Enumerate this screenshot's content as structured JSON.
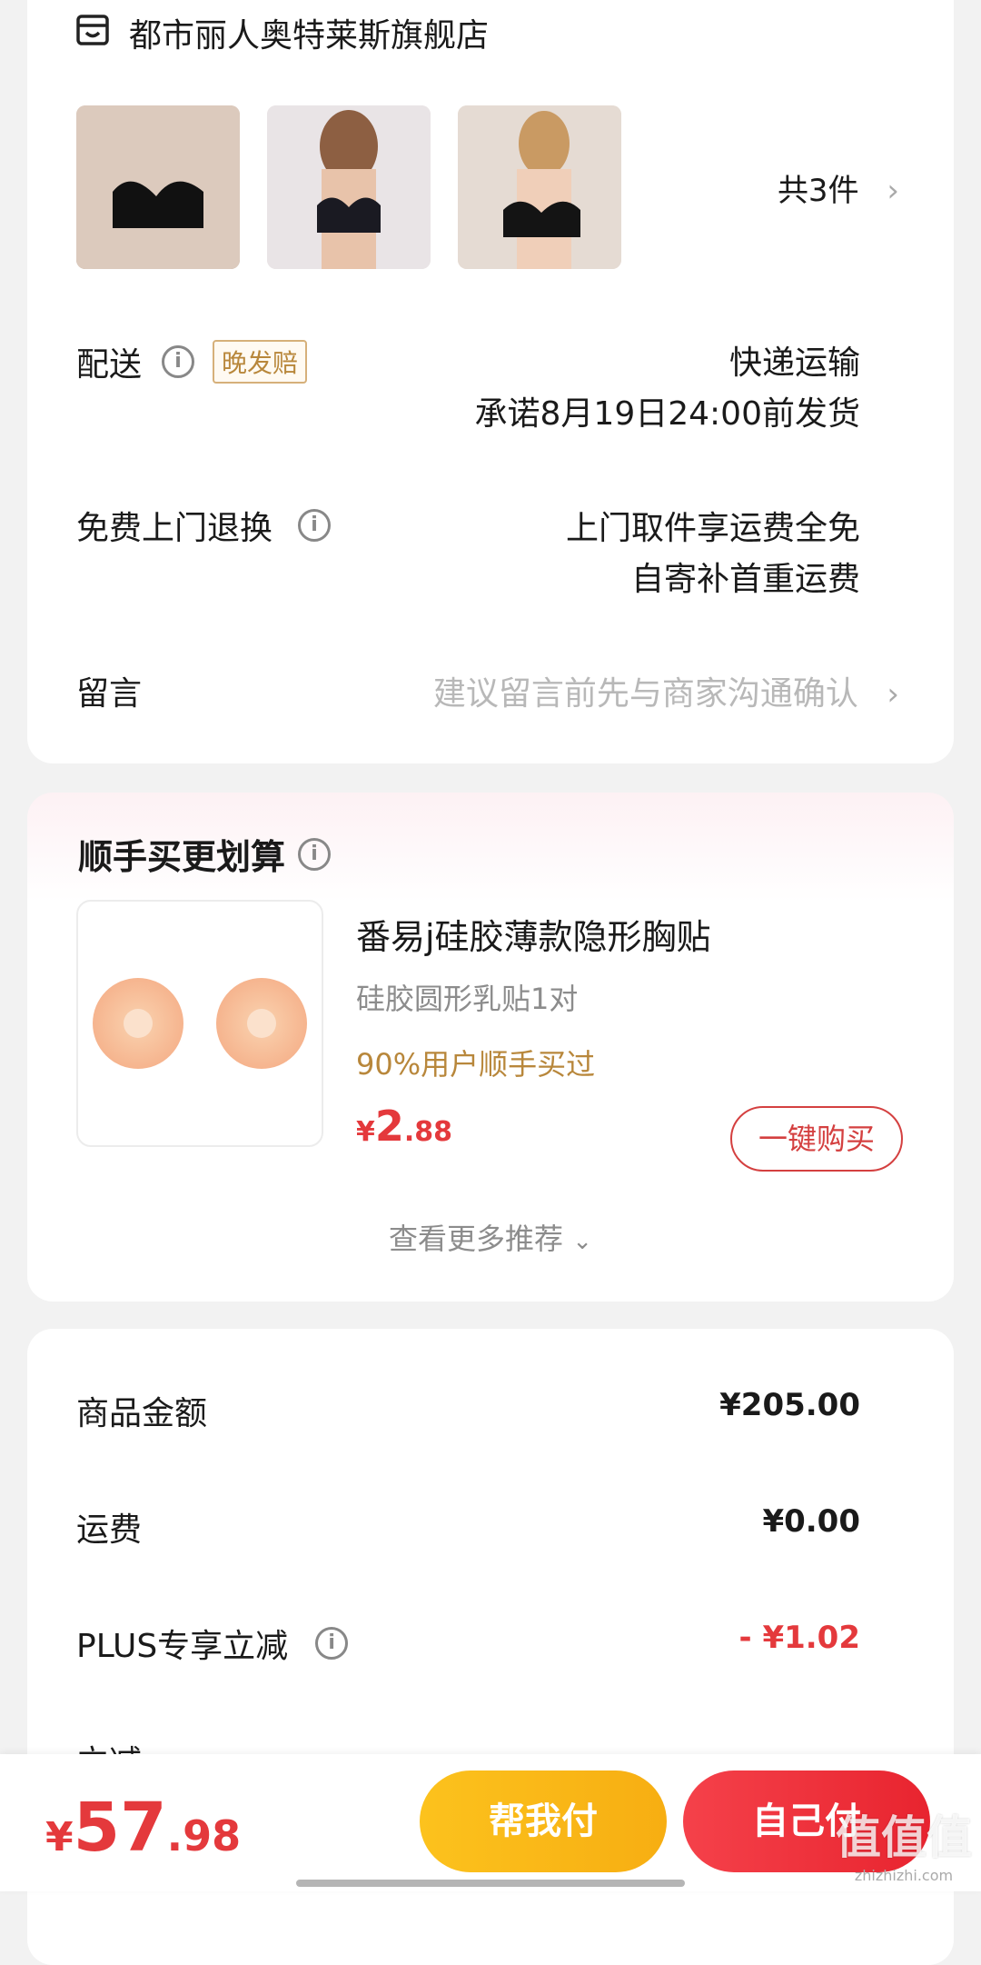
{
  "store": {
    "name": "都市丽人奥特莱斯旗舰店",
    "icon": "store-icon"
  },
  "products": {
    "count_label": "共3件"
  },
  "delivery": {
    "label": "配送",
    "badge": "晚发赔",
    "method": "快递运输",
    "promise": "承诺8月19日24:00前发货"
  },
  "returns": {
    "label": "免费上门退换",
    "line1": "上门取件享运费全免",
    "line2": "自寄补首重运费"
  },
  "message": {
    "label": "留言",
    "placeholder": "建议留言前先与商家沟通确认"
  },
  "addon": {
    "title": "顺手买更划算",
    "product_title": "番易j硅胶薄款隐形胸贴",
    "spec": "硅胶圆形乳贴1对",
    "social_proof": "90%用户顺手买过",
    "price_symbol": "¥",
    "price_int": "2",
    "price_dec": ".88",
    "buy_label": "一键购买",
    "more_label": "查看更多推荐"
  },
  "summary": {
    "goods_label": "商品金额",
    "goods_value": "¥205.00",
    "shipping_label": "运费",
    "shipping_value": "¥0.00",
    "plus_label": "PLUS专享立减",
    "plus_value": "- ¥1.02",
    "partial_label": "立减"
  },
  "footer": {
    "symbol": "¥",
    "total_int": "57",
    "total_dec": ".98",
    "help_pay": "帮我付",
    "self_pay": "自己付"
  },
  "watermark": {
    "text": "值值值",
    "sub": "zhizhizhi.com"
  },
  "colors": {
    "accent_red": "#e4393c",
    "gold": "#b8873b",
    "yellow_btn": "#f9b917"
  }
}
